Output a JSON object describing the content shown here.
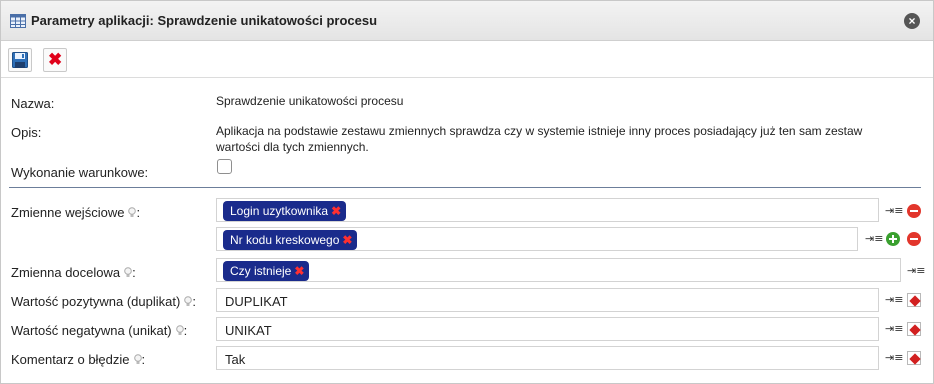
{
  "dialog": {
    "title": "Parametry aplikacji: Sprawdzenie unikatowości procesu",
    "close_label": "×"
  },
  "toolbar": {
    "cancel_glyph": "✖"
  },
  "form": {
    "name_label": "Nazwa:",
    "name_value": "Sprawdzenie unikatowości procesu",
    "description_label": "Opis:",
    "description_value": "Aplikacja na podstawie zestawu zmiennych sprawdza czy w systemie istnieje inny proces posiadający już ten sam zestaw wartości dla tych zmiennych.",
    "conditional_label": "Wykonanie warunkowe:",
    "conditional_checked": false,
    "input_vars_label": "Zmienne wejściowe",
    "input_vars": [
      "Login uzytkownika",
      "Nr kodu kreskowego"
    ],
    "target_var_label": "Zmienna docelowa",
    "target_var": "Czy istnieje",
    "positive_label": "Wartość pozytywna (duplikat)",
    "positive_value": "DUPLIKAT",
    "negative_label": "Wartość negatywna (unikat)",
    "negative_value": "UNIKAT",
    "error_comment_label": "Komentarz o błędzie",
    "error_comment_value": "Tak",
    "colon": ":",
    "chip_remove_glyph": "✖",
    "list_icon_glyph": "⇥≡"
  },
  "colors": {
    "chip_bg": "#1a2b8c",
    "chip_remove": "#ff3030",
    "separator": "#6c7e9a",
    "remove_icon": "#e2362c",
    "add_icon": "#3aa02f"
  },
  "icons": {
    "title": "table-icon",
    "close": "close-icon",
    "save": "floppy-disk-icon",
    "cancel": "red-x-icon",
    "hint": "lightbulb-icon",
    "variable_picker": "variable-list-icon",
    "remove_row": "minus-circle-icon",
    "add_row": "plus-circle-icon",
    "clear_value": "eraser-icon"
  }
}
